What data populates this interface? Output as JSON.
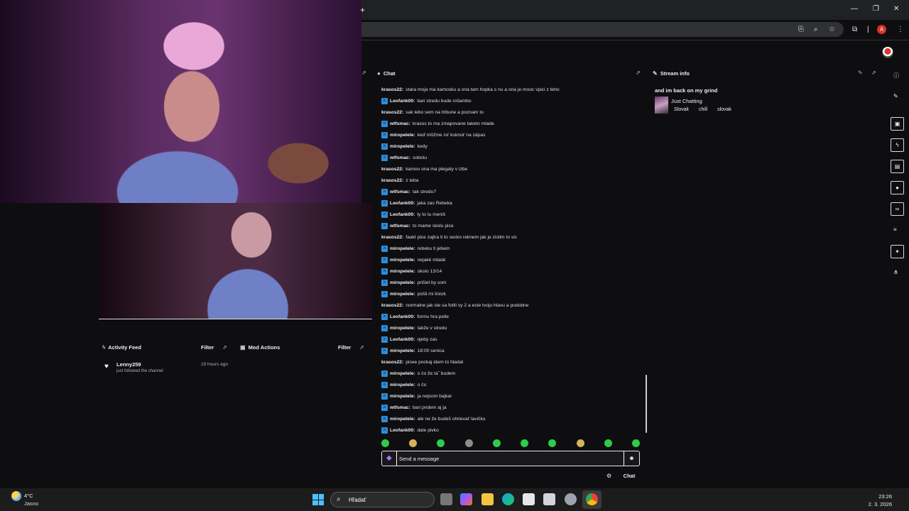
{
  "browser": {
    "new_tab": "+",
    "minimize": "—",
    "restore": "❐",
    "close": "✕",
    "profile_initial": "A"
  },
  "chat": {
    "title": "Chat",
    "messages": [
      {
        "user": "krasos22",
        "text": "stara moja ma kamosku a ona tam hopka s nu a ona je mooc vpici z teho",
        "mod": false
      },
      {
        "user": "Leofank00",
        "text": "bari stredu bude rošambo",
        "mod": true
      },
      {
        "user": "krasos22",
        "text": "sak lebo sem na tribune a poznam to",
        "mod": false
      },
      {
        "user": "wtfsmac",
        "text": "krasos to ma zmapovane taketo mlade",
        "mod": true
      },
      {
        "user": "miropelele",
        "text": "keď môžme ísť kuknúť na zápas",
        "mod": true
      },
      {
        "user": "miropelele",
        "text": "kedy",
        "mod": true
      },
      {
        "user": "wtfsmac",
        "text": "sobotu",
        "mod": true
      },
      {
        "user": "krasos22",
        "text": "kamoo ona ma plegaty v izbe",
        "mod": false
      },
      {
        "user": "krasos22",
        "text": "z teba",
        "mod": false
      },
      {
        "user": "wtfsmac",
        "text": "tak stredu?",
        "mod": true
      },
      {
        "user": "Leofank00",
        "text": "jaka zas Rebeka",
        "mod": true
      },
      {
        "user": "Leofank00",
        "text": "ty to tu meniš",
        "mod": true
      },
      {
        "user": "wtfsmac",
        "text": "to mame skolu pice",
        "mod": true
      },
      {
        "user": "krasos22",
        "text": "faakt pice zajtra ti to secko reknem jak je zistim to vic",
        "mod": false
      },
      {
        "user": "miropelele",
        "text": "rebeku ti jebem",
        "mod": true
      },
      {
        "user": "miropelele",
        "text": "nejaké mladé",
        "mod": true
      },
      {
        "user": "miropelele",
        "text": "okolo 13/14",
        "mod": true
      },
      {
        "user": "miropelele",
        "text": "prišiel by som",
        "mod": true
      },
      {
        "user": "miropelele",
        "text": "pošli mi lístok",
        "mod": true
      },
      {
        "user": "krasos22",
        "text": "normalne jak ste sa fotili vy 2 a este tvoju hlavu a podobne",
        "mod": false
      },
      {
        "user": "Leofank00",
        "text": "formu hra pelle",
        "mod": true
      },
      {
        "user": "miropelele",
        "text": "takže v stredu",
        "mod": true
      },
      {
        "user": "Leofank00",
        "text": "ojeby zas",
        "mod": true
      },
      {
        "user": "miropelele",
        "text": "18:00 senica",
        "mod": true
      },
      {
        "user": "krasos22",
        "text": "picee pockaj idem to hladat",
        "mod": false
      },
      {
        "user": "miropelele",
        "text": "o čo že ta˜ budem",
        "mod": true
      },
      {
        "user": "miropelele",
        "text": "o čo",
        "mod": true
      },
      {
        "user": "miropelele",
        "text": "ja nejsom bajkar",
        "mod": true
      },
      {
        "user": "wtfsmac",
        "text": "bari pridem aj ja",
        "mod": true
      },
      {
        "user": "miropelele",
        "text": "ale ne že budeš ohrievať lavičku",
        "mod": true
      },
      {
        "user": "Leofank00",
        "text": "date pivko",
        "mod": true
      }
    ],
    "input_placeholder": "Send a message",
    "chat_button": "Chat",
    "emote_icon": "smiley-icon"
  },
  "stream_info": {
    "title": "Stream info",
    "stream_title": "and im back on my grind",
    "category": "Just Chatting",
    "tags": [
      "Slovak",
      "chill",
      "slovak"
    ]
  },
  "activity_feed": {
    "title": "Activity Feed",
    "filter": "Filter",
    "items": [
      {
        "user": "Lenny259",
        "action": "just followed the channel",
        "time": "19 hours ago"
      }
    ]
  },
  "mod_actions": {
    "title": "Mod Actions",
    "filter": "Filter"
  },
  "taskbar": {
    "temperature": "4°C",
    "condition": "Jasno",
    "search": "Hľadať",
    "time": "23:26",
    "date": "2. 3. 2026"
  },
  "colors": {
    "mod_badge": "#2e8ddb",
    "background": "#0e0e10",
    "bits_purple": "#a970ff"
  }
}
